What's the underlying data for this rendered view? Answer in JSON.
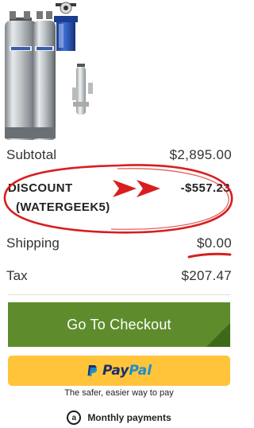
{
  "summary": {
    "subtotal_label": "Subtotal",
    "subtotal_value": "$2,895.00",
    "discount_label": "DISCOUNT",
    "discount_code": "(WATERGEEK5)",
    "discount_value": "-$557.23",
    "shipping_label": "Shipping",
    "shipping_value": "$0.00",
    "tax_label": "Tax",
    "tax_value": "$207.47"
  },
  "checkout": {
    "label": "Go To Checkout",
    "color": "#5e8c2c"
  },
  "paypal": {
    "logo_pay": "Pay",
    "logo_pal": "Pal",
    "tagline": "The safer, easier way to pay",
    "color": "#ffc439"
  },
  "monthly": {
    "icon_letter": "a",
    "label": "Monthly payments"
  },
  "annotation": {
    "color": "#d81e1e"
  }
}
